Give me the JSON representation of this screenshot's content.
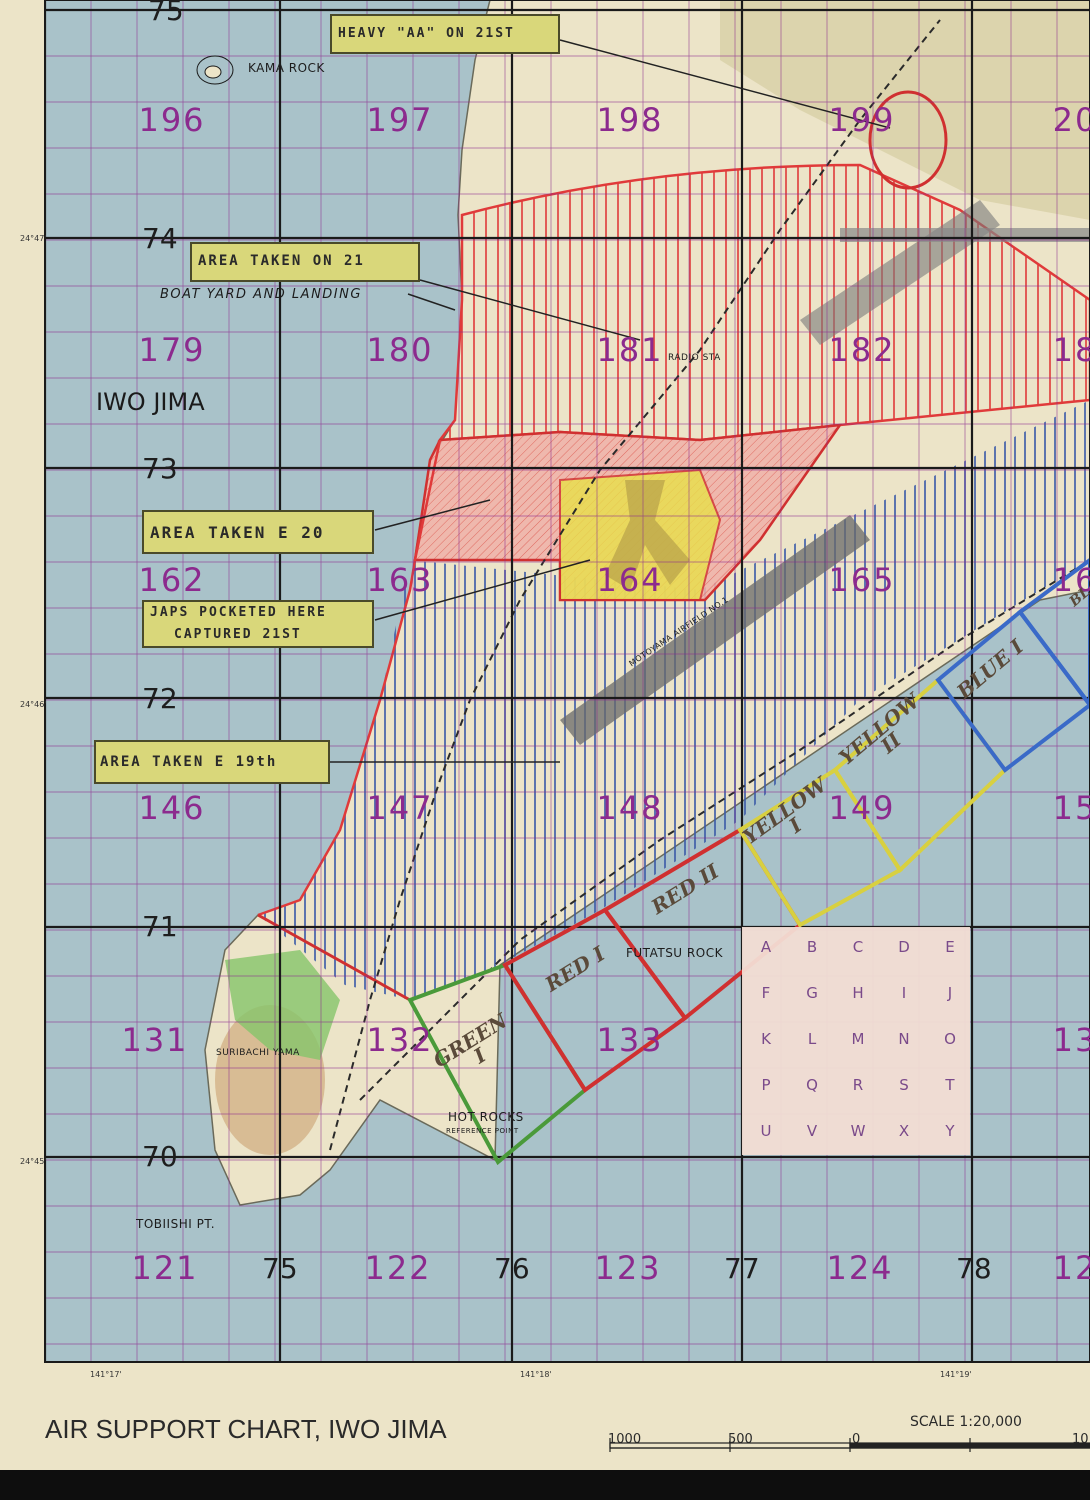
{
  "title": "AIR SUPPORT CHART, IWO JIMA",
  "scale": {
    "label": "SCALE 1:20,000",
    "ticks": [
      "1000",
      "500",
      "0",
      "10"
    ]
  },
  "island_name": "IWO JIMA",
  "grid_lines_y": [
    "75",
    "74",
    "73",
    "72",
    "71",
    "70"
  ],
  "grid_lines_x": [
    "75",
    "76",
    "77",
    "78"
  ],
  "squares": [
    "196",
    "197",
    "198",
    "199",
    "20",
    "179",
    "180",
    "181",
    "182",
    "18",
    "162",
    "163",
    "164",
    "165",
    "16",
    "146",
    "147",
    "148",
    "149",
    "15",
    "131",
    "132",
    "133",
    "13",
    "121",
    "122",
    "123",
    "124",
    "12"
  ],
  "places": {
    "kama_rock": "KAMA ROCK",
    "boat_yard": "BOAT YARD AND LANDING",
    "radio_sta": "RADIO STA",
    "futatsu_rock": "FUTATSU ROCK",
    "suribachi": "SURIBACHI YAMA",
    "hot_rocks": "HOT ROCKS",
    "reference_point": "REFERENCE POINT",
    "tobiishi": "TOBIISHI PT.",
    "motoyama_airfield": "MOTOYAMA AIRFIELD NO.1"
  },
  "callouts": {
    "heavy_aa": "HEAVY \"AA\" ON 21ST",
    "area_21": "AREA TAKEN ON 21",
    "area_20": "AREA TAKEN E 20",
    "japs_pocketed_1": "JAPS POCKETED HERE",
    "japs_pocketed_2": "CAPTURED 21ST",
    "area_19": "AREA TAKEN E 19th"
  },
  "beaches": {
    "green1": "GREEN I",
    "red1": "RED I",
    "red2": "RED II",
    "yellow1": "YELLOW I",
    "yellow2": "YELLOW II",
    "blue1": "BLUE I",
    "blue_partial": "BL"
  },
  "subgrid_letters": [
    "A",
    "B",
    "C",
    "D",
    "E",
    "F",
    "G",
    "H",
    "I",
    "J",
    "K",
    "L",
    "M",
    "N",
    "O",
    "P",
    "Q",
    "R",
    "S",
    "T",
    "U",
    "V",
    "W",
    "X",
    "Y"
  ],
  "coords": {
    "lat_74": "24°47'",
    "lat_72": "24°46'",
    "lat_70": "24°45'",
    "lon_17": "141°17'",
    "lon_18": "141°18'",
    "lon_19": "141°19'"
  },
  "colors": {
    "sea": "#a9c2c9",
    "land": "#ece4c8",
    "red_hatch": "#e03a3a",
    "blue_hatch": "#3a5aa8",
    "yellow": "#e8e04a",
    "green": "#6ab04a",
    "grid_purple": "#8c2a8e"
  }
}
